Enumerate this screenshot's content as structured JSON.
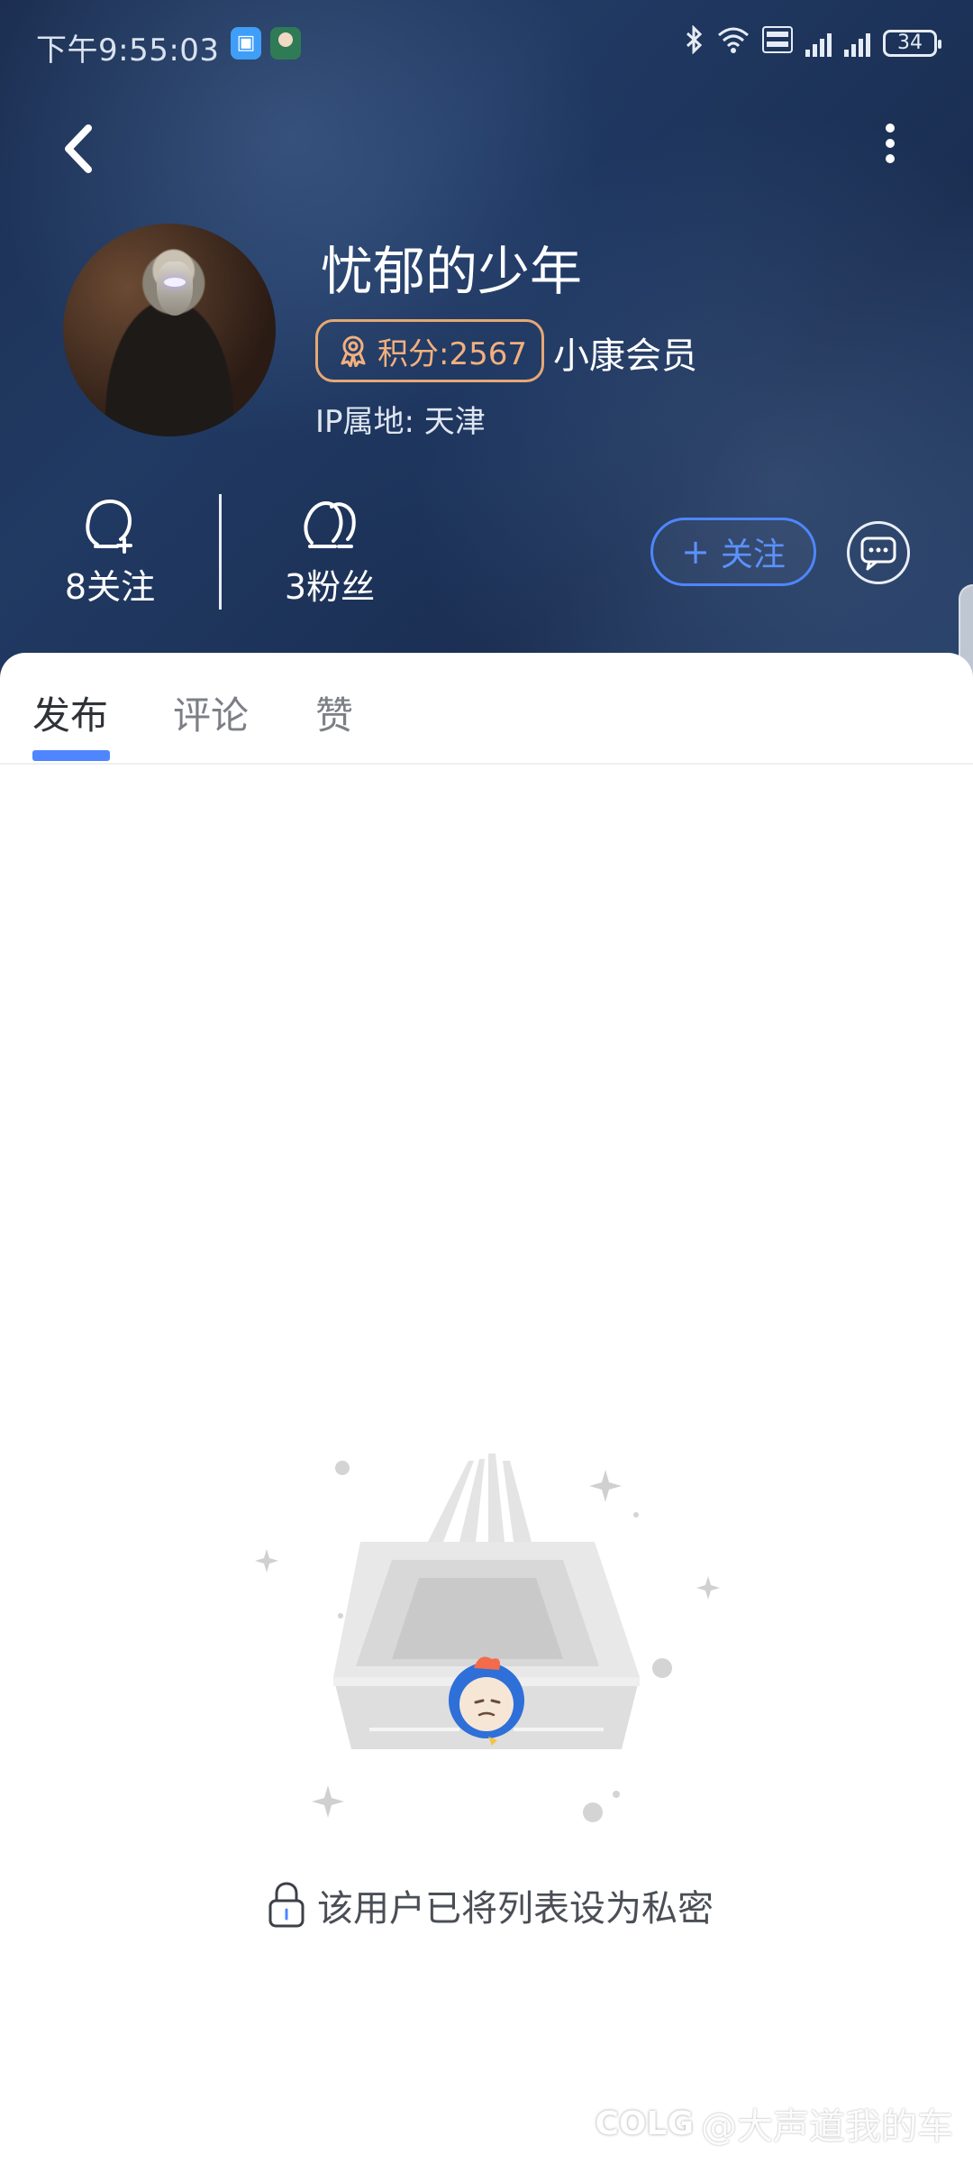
{
  "status_bar": {
    "time": "下午9:55:03",
    "battery": "34"
  },
  "profile": {
    "username": "忧郁的少年",
    "points": "积分:2567",
    "member_label": "小康会员",
    "ip_location": "IP属地: 天津"
  },
  "stats": {
    "following": "8关注",
    "fans": "3粉丝"
  },
  "actions": {
    "follow_label": "关注"
  },
  "tabs": [
    {
      "label": "发布"
    },
    {
      "label": "评论"
    },
    {
      "label": "赞"
    }
  ],
  "empty_state": {
    "message": "该用户已将列表设为私密"
  },
  "watermark": {
    "logo": "COLG",
    "text": "@大声道我的车"
  },
  "colors": {
    "accent": "#4f86ff",
    "badge": "#e6a874",
    "header_bg": "#1f355c"
  }
}
